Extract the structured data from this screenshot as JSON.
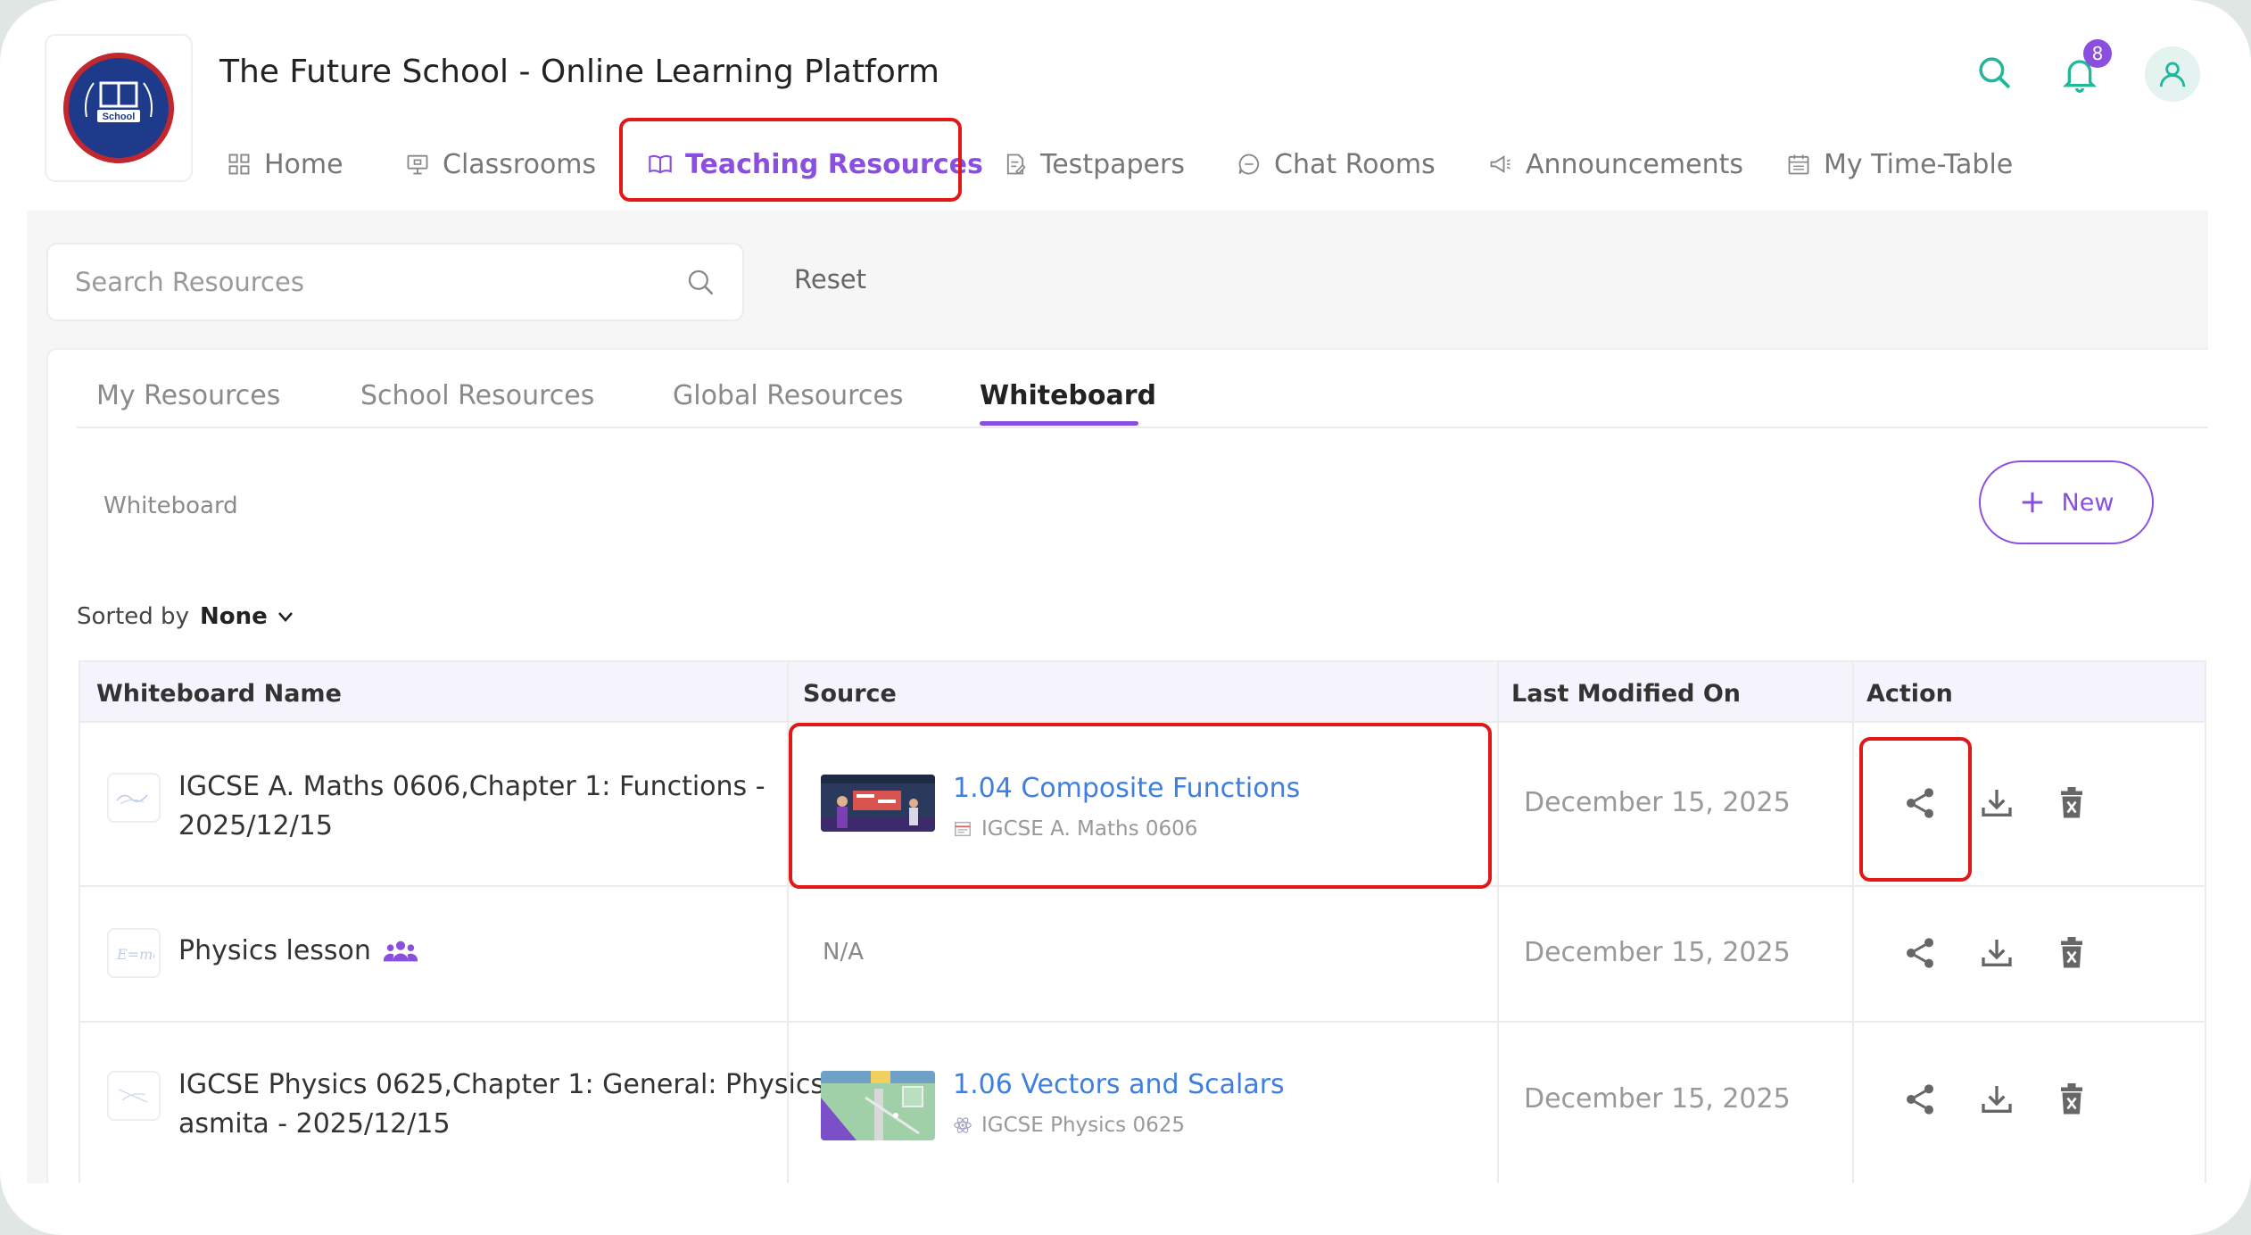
{
  "app": {
    "title": "The Future School - Online Learning Platform",
    "logo_text": "School"
  },
  "nav": [
    {
      "label": "Home",
      "icon": "grid-icon"
    },
    {
      "label": "Classrooms",
      "icon": "presentation-icon"
    },
    {
      "label": "Teaching Resources",
      "icon": "book-icon",
      "active": true
    },
    {
      "label": "Testpapers",
      "icon": "document-edit-icon"
    },
    {
      "label": "Chat Rooms",
      "icon": "chat-icon"
    },
    {
      "label": "Announcements",
      "icon": "megaphone-icon"
    },
    {
      "label": "My Time-Table",
      "icon": "calendar-icon"
    }
  ],
  "header": {
    "notification_count": "8"
  },
  "search": {
    "placeholder": "Search Resources",
    "value": "",
    "reset_label": "Reset"
  },
  "tabs": [
    {
      "label": "My Resources"
    },
    {
      "label": "School Resources"
    },
    {
      "label": "Global Resources"
    },
    {
      "label": "Whiteboard",
      "active": true
    }
  ],
  "section": {
    "label": "Whiteboard",
    "new_label": "New"
  },
  "sort": {
    "label": "Sorted by",
    "value": "None"
  },
  "table": {
    "headers": [
      "Whiteboard Name",
      "Source",
      "Last Modified On",
      "Action"
    ],
    "rows": [
      {
        "name_line1": "IGCSE A. Maths 0606,Chapter 1: Functions -",
        "name_line2": "2025/12/15",
        "source_title": "1.04 Composite Functions",
        "source_sub": "IGCSE A. Maths 0606",
        "modified": "December 15, 2025"
      },
      {
        "name_line1": "Physics lesson",
        "shared": true,
        "source_na": "N/A",
        "modified": "December 15, 2025"
      },
      {
        "name_line1": "IGCSE Physics 0625,Chapter 1: General: Physics",
        "name_line2": "asmita - 2025/12/15",
        "source_title": "1.06 Vectors and Scalars",
        "source_sub": "IGCSE Physics 0625",
        "modified": "December 15, 2025"
      }
    ]
  },
  "colors": {
    "accent": "#8b4fe0",
    "link": "#3f7fe0",
    "highlight": "#e01818",
    "teal": "#1fb89a"
  }
}
